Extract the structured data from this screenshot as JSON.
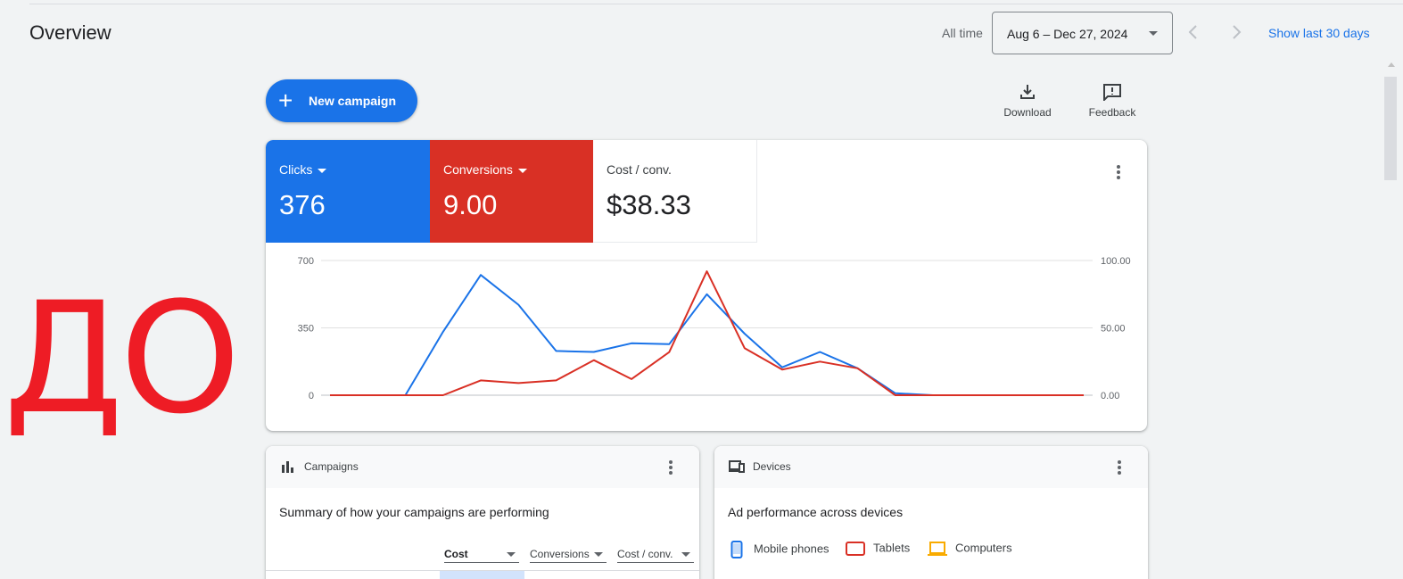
{
  "header": {
    "title": "Overview",
    "all_time_label": "All time",
    "date_range": "Aug 6 – Dec 27, 2024",
    "show_last_label": "Show last 30 days"
  },
  "actions": {
    "new_campaign_label": "New campaign",
    "download_label": "Download",
    "feedback_label": "Feedback"
  },
  "metrics": [
    {
      "name": "Clicks",
      "value": "376",
      "color": "#1a73e8"
    },
    {
      "name": "Conversions",
      "value": "9.00",
      "color": "#d93025"
    },
    {
      "name": "Cost / conv.",
      "value": "$38.33",
      "color": "#ffffff"
    }
  ],
  "chart_data": {
    "type": "line",
    "y_left_ticks": [
      "700",
      "350",
      "0"
    ],
    "y_right_ticks": [
      "100.00",
      "50.00",
      "0.00"
    ],
    "ylim_left": [
      0,
      700
    ],
    "ylim_right": [
      0,
      100
    ],
    "grid": true,
    "series": [
      {
        "axis": "left",
        "color": "#1a73e8",
        "values": [
          0,
          0,
          0,
          330,
          625,
          470,
          230,
          225,
          270,
          265,
          525,
          320,
          145,
          225,
          140,
          10,
          0,
          0,
          0,
          0,
          0
        ]
      },
      {
        "axis": "right",
        "color": "#d93025",
        "values": [
          0,
          0,
          0,
          0,
          11,
          9,
          11,
          26,
          12,
          32,
          92,
          35,
          19,
          25,
          20,
          0,
          0,
          0,
          0,
          0,
          0
        ]
      }
    ]
  },
  "campaigns_card": {
    "title": "Campaigns",
    "description": "Summary of how your campaigns are performing",
    "columns": [
      "Cost",
      "Conversions",
      "Cost / conv."
    ]
  },
  "devices_card": {
    "title": "Devices",
    "description": "Ad performance across devices",
    "legend": [
      {
        "label": "Mobile phones",
        "color": "#1a73e8"
      },
      {
        "label": "Tablets",
        "color": "#d93025"
      },
      {
        "label": "Computers",
        "color": "#f9ab00"
      }
    ]
  },
  "overlay": {
    "text": "ДО",
    "color": "#ee1c25"
  }
}
